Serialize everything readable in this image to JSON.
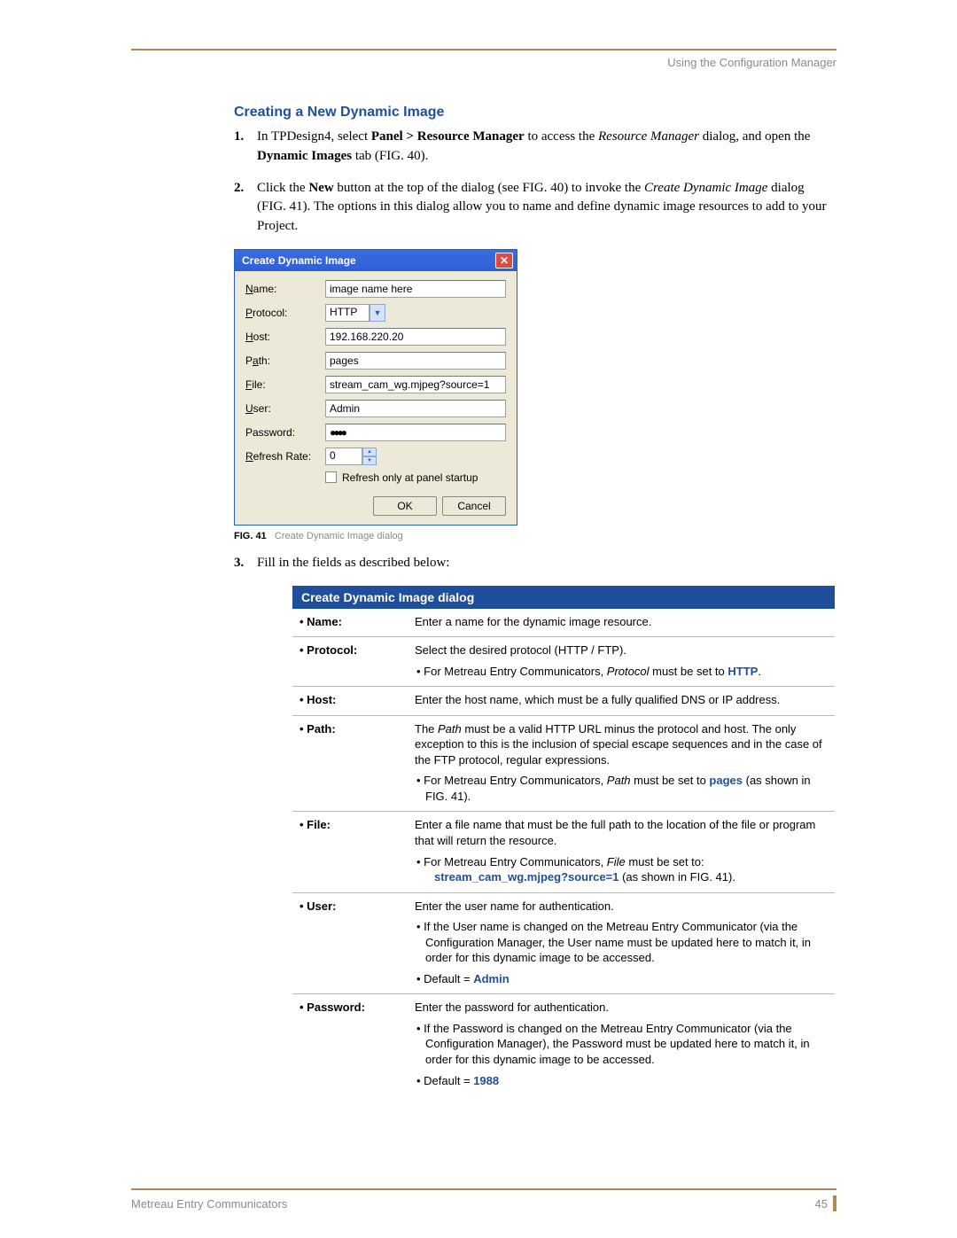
{
  "header": {
    "right": "Using the Configuration Manager"
  },
  "section_heading": "Creating a New Dynamic Image",
  "steps": {
    "s1": {
      "pre": "In TPDesign4, select ",
      "b1": "Panel > Resource Manager",
      "mid1": " to access the ",
      "i1": "Resource Manager",
      "mid2": " dialog, and open the ",
      "b2": "Dynamic Images",
      "post": " tab (FIG. 40)."
    },
    "s2": {
      "pre": "Click the ",
      "b1": "New",
      "mid1": " button at the top of the dialog (see FIG. 40) to invoke the ",
      "i1": "Create Dynamic Image",
      "post": " dialog (FIG. 41). The options in this dialog allow you to name and define dynamic image resources to add to your Project."
    },
    "s3": "Fill in the fields as described below:"
  },
  "dialog": {
    "title": "Create Dynamic Image",
    "labels": {
      "name": "Name:",
      "protocol": "Protocol:",
      "host": "Host:",
      "path": "Path:",
      "file": "File:",
      "user": "User:",
      "password": "Password:",
      "refresh": "Refresh Rate:"
    },
    "values": {
      "name": "image name here",
      "protocol": "HTTP",
      "host": "192.168.220.20",
      "path": "pages",
      "file": "stream_cam_wg.mjpeg?source=1",
      "user": "Admin",
      "password": "●●●●",
      "refresh": "0"
    },
    "checkbox": "Refresh only at panel startup",
    "ok": "OK",
    "cancel": "Cancel"
  },
  "fig": {
    "label": "FIG. 41",
    "text": "Create Dynamic Image dialog"
  },
  "table": {
    "title": "Create Dynamic Image dialog",
    "rows": {
      "name": {
        "label": "Name:",
        "desc": "Enter a name for the dynamic image resource."
      },
      "protocol": {
        "label": "Protocol:",
        "desc": "Select the desired protocol (HTTP / FTP).",
        "sub_pre": "For Metreau Entry Communicators, ",
        "sub_i": "Protocol",
        "sub_mid": " must be set to ",
        "sub_hl": "HTTP",
        "sub_post": "."
      },
      "host": {
        "label": "Host:",
        "desc": "Enter the host name, which must be a fully qualified DNS or IP address."
      },
      "path": {
        "label": "Path:",
        "desc_pre": "The ",
        "desc_i": "Path",
        "desc_post": " must be a valid HTTP URL minus the protocol and host. The only exception to this is the inclusion of special escape sequences and in the case of the FTP protocol, regular expressions.",
        "sub_pre": "For Metreau Entry Communicators, ",
        "sub_i": "Path",
        "sub_mid": " must be set to ",
        "sub_hl": "pages",
        "sub_post": " (as shown in FIG. 41)."
      },
      "file": {
        "label": "File:",
        "desc": "Enter a file name that must be the full path to the location of the file or program that will return the resource.",
        "sub_pre": "For Metreau Entry Communicators, ",
        "sub_i": "File",
        "sub_mid": " must be set to: ",
        "sub_hl": "stream_cam_wg.mjpeg?source=1",
        "sub_post": " (as shown in FIG. 41)."
      },
      "user": {
        "label": "User:",
        "desc": "Enter the user name for authentication.",
        "sub1": "If the User name is changed on the Metreau Entry Communicator (via the Configuration Manager, the User name must be updated here to match it, in order for this dynamic image to be accessed.",
        "def_pre": "Default = ",
        "def_hl": "Admin"
      },
      "password": {
        "label": "Password:",
        "desc": "Enter the password for authentication.",
        "sub1": "If the Password is changed on the Metreau Entry Communicator (via the Configuration Manager), the Password must be updated here to match it, in order for this dynamic image to be accessed.",
        "def_pre": "Default = ",
        "def_hl": "1988"
      }
    }
  },
  "footer": {
    "left": "Metreau Entry Communicators",
    "page": "45"
  }
}
